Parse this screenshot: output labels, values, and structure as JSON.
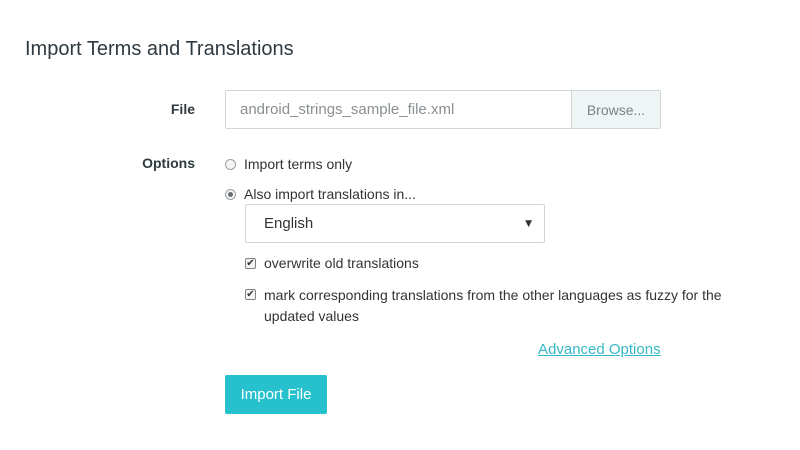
{
  "page": {
    "title": "Import Terms and Translations"
  },
  "file": {
    "label": "File",
    "value": "android_strings_sample_file.xml",
    "browse_label": "Browse..."
  },
  "options": {
    "label": "Options",
    "import_terms_only": {
      "label": "Import terms only",
      "checked": false
    },
    "also_import_translations": {
      "label": "Also import translations in...",
      "checked": true
    },
    "language_select": {
      "selected": "English"
    },
    "overwrite": {
      "label": "overwrite old translations",
      "checked": true
    },
    "mark_fuzzy": {
      "label": "mark corresponding translations from the other languages as fuzzy for the updated values",
      "checked": true
    }
  },
  "advanced_link": "Advanced Options",
  "import_button": "Import File",
  "colors": {
    "accent": "#26c1cd",
    "link": "#35b8c6",
    "browse_bg": "#eef5f4"
  }
}
